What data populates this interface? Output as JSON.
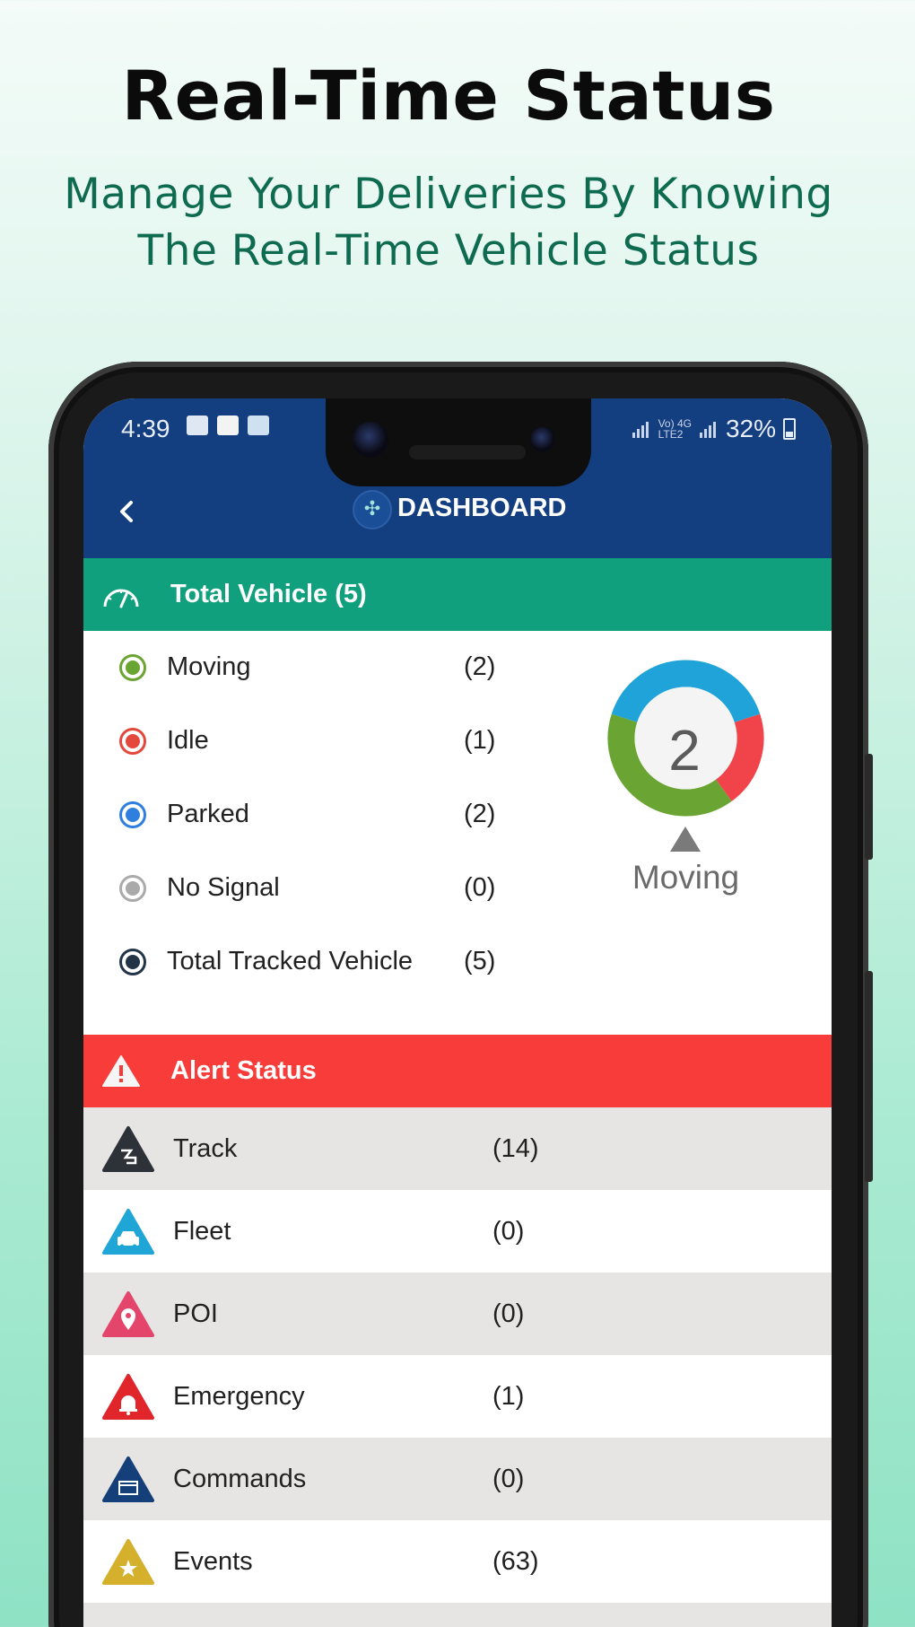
{
  "headline": "Real-Time Status",
  "subheadline_line1": "Manage Your Deliveries By Knowing",
  "subheadline_line2": "The Real-Time Vehicle Status",
  "statusbar": {
    "time": "4:39",
    "network_top": "Vo) 4G",
    "network_bottom": "LTE2",
    "battery": "32%"
  },
  "appbar": {
    "title": "DASHBOARD",
    "back_icon": "chevron-left-icon"
  },
  "total_vehicle": {
    "label": "Total Vehicle (5)",
    "icon": "speedometer-icon",
    "color": "#10a07d"
  },
  "status_items": [
    {
      "label": "Moving",
      "count": "(2)",
      "color": "#6aa432"
    },
    {
      "label": "Idle",
      "count": "(1)",
      "color": "#e4483c"
    },
    {
      "label": "Parked",
      "count": "(2)",
      "color": "#2f7fde"
    },
    {
      "label": "No Signal",
      "count": "(0)",
      "color": "#aaaaaa"
    },
    {
      "label": "Total Tracked Vehicle",
      "count": "(5)",
      "color": "#243447"
    }
  ],
  "donut": {
    "center_value": "2",
    "caption": "Moving",
    "segments": [
      {
        "name": "Moving",
        "value": 2,
        "color": "#6aa432"
      },
      {
        "name": "Idle",
        "value": 1,
        "color": "#f0444a"
      },
      {
        "name": "Parked",
        "value": 2,
        "color": "#1fa3d8"
      }
    ]
  },
  "alert_status": {
    "label": "Alert Status",
    "icon": "warning-icon",
    "color": "#f73c3a"
  },
  "alerts": [
    {
      "label": "Track",
      "count": "(14)",
      "icon": "track-icon",
      "color": "#2d3238"
    },
    {
      "label": "Fleet",
      "count": "(0)",
      "icon": "car-icon",
      "color": "#1fa6d6"
    },
    {
      "label": "POI",
      "count": "(0)",
      "icon": "pin-icon",
      "color": "#e4456a"
    },
    {
      "label": "Emergency",
      "count": "(1)",
      "icon": "bell-icon",
      "color": "#e0252b"
    },
    {
      "label": "Commands",
      "count": "(0)",
      "icon": "terminal-icon",
      "color": "#143f78"
    },
    {
      "label": "Events",
      "count": "(63)",
      "icon": "star-icon",
      "color": "#d4b02c"
    }
  ]
}
